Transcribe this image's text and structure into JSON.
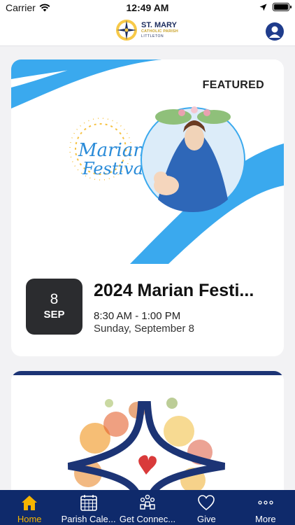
{
  "status_bar": {
    "carrier": "Carrier",
    "time": "12:49 AM"
  },
  "header": {
    "logo_name": "ST. MARY",
    "logo_sub": "CATHOLIC PARISH",
    "logo_city": "LITTLETON"
  },
  "featured": {
    "label": "FEATURED",
    "image_text_line1": "Marian",
    "image_text_line2": "Festival",
    "day": "8",
    "month": "SEP",
    "title": "2024 Marian Festi...",
    "time": "8:30 AM - 1:00 PM",
    "date": "Sunday, September 8"
  },
  "tabs": [
    {
      "label": "Home",
      "icon": "home-icon",
      "active": true
    },
    {
      "label": "Parish Cale...",
      "icon": "calendar-icon",
      "active": false
    },
    {
      "label": "Get Connec...",
      "icon": "people-icon",
      "active": false
    },
    {
      "label": "Give",
      "icon": "heart-icon",
      "active": false
    },
    {
      "label": "More",
      "icon": "more-icon",
      "active": false
    }
  ],
  "colors": {
    "nav_blue": "#0f2a6b",
    "active_tab": "#f5b400",
    "festival_blue": "#3aa9ee"
  }
}
